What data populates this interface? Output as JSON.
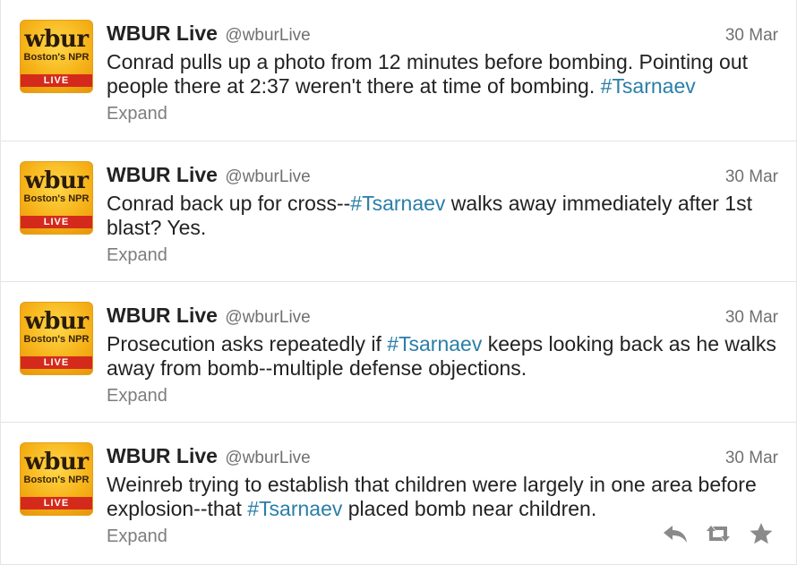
{
  "tweets": [
    {
      "name": "WBUR Live",
      "handle": "@wburLive",
      "time": "30 Mar",
      "text_parts": [
        "Conrad pulls up a photo from 12 minutes before bombing. Pointing out people there at 2:37 weren't there at time of bombing. ",
        "#Tsarnaev",
        ""
      ],
      "expand": "Expand"
    },
    {
      "name": "WBUR Live",
      "handle": "@wburLive",
      "time": "30 Mar",
      "text_parts": [
        "Conrad back up for cross--",
        "#Tsarnaev",
        " walks away immediately after 1st blast? Yes."
      ],
      "expand": "Expand"
    },
    {
      "name": "WBUR Live",
      "handle": "@wburLive",
      "time": "30 Mar",
      "text_parts": [
        "Prosecution asks repeatedly if ",
        "#Tsarnaev",
        " keeps looking back as he walks away from bomb--multiple defense objections."
      ],
      "expand": "Expand"
    },
    {
      "name": "WBUR Live",
      "handle": "@wburLive",
      "time": "30 Mar",
      "text_parts": [
        "Weinreb trying to establish that children were largely in one area before explosion--that ",
        "#Tsarnaev",
        " placed bomb near children."
      ],
      "expand": "Expand"
    }
  ],
  "avatar": {
    "wordmark": "wbur",
    "tagline": "Boston's NPR",
    "badge": "LIVE"
  },
  "action_icons": [
    "reply-icon",
    "retweet-icon",
    "favorite-icon"
  ],
  "colors": {
    "hashtag": "#2a7ea8",
    "live_badge": "#d42a1c",
    "avatar_gold": "#f6b319"
  }
}
